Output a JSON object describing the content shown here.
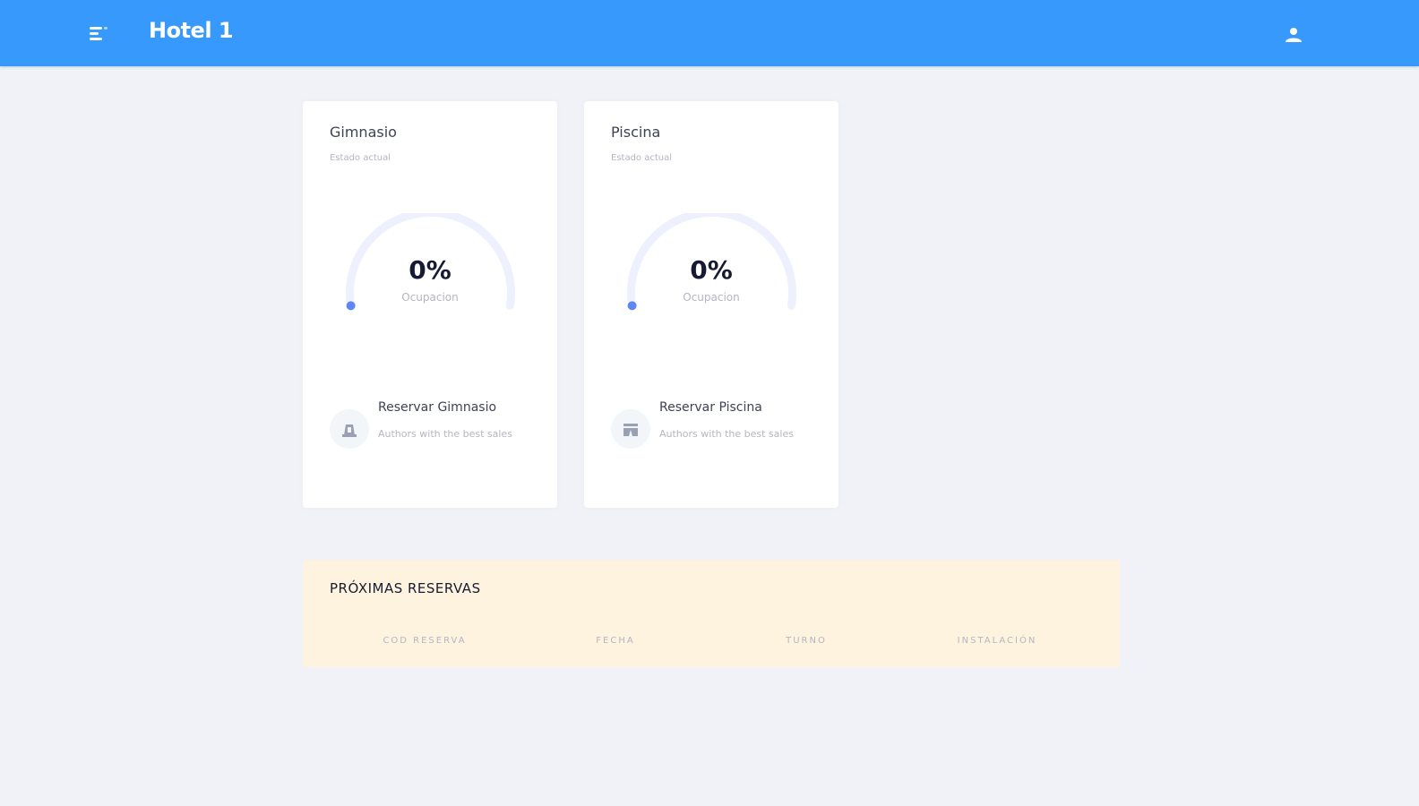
{
  "header": {
    "title": "Hotel 1",
    "menu_icon": "menu-icon",
    "user_icon": "user-icon",
    "background_color": "#3899fc"
  },
  "cards": [
    {
      "title": "Gimnasio",
      "subtitle": "Estado actual",
      "gauge_value": "0%",
      "gauge_label": "Ocupacion",
      "occupancy_fraction": 0,
      "action_title": "Reservar Gimnasio",
      "action_desc": "Authors with the best sales",
      "action_icon": "gym-icon"
    },
    {
      "title": "Piscina",
      "subtitle": "Estado actual",
      "gauge_value": "0%",
      "gauge_label": "Ocupacion",
      "occupancy_fraction": 0,
      "action_title": "Reservar Piscina",
      "action_desc": "Authors with the best sales",
      "action_icon": "pool-icon"
    }
  ],
  "reservations": {
    "title": "PRÓXIMAS RESERVAS",
    "columns": [
      "COD RESERVA",
      "FECHA",
      "TURNO",
      "INSTALACIÓN"
    ],
    "rows": [],
    "background_color": "#fef3de"
  },
  "colors": {
    "accent": "#3899fc",
    "gauge_track": "#eef1fd",
    "gauge_dot": "#5f87f3"
  }
}
